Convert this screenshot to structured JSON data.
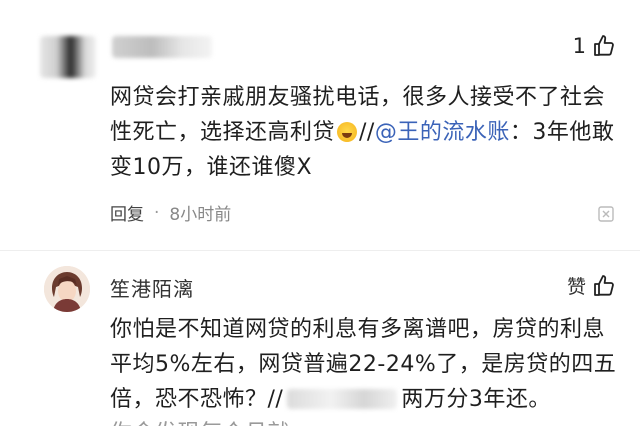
{
  "comment1": {
    "like_count": "1",
    "text_part1": "网贷会打亲戚朋友骚扰电话，很多人接受不了社会性死亡，选择还高利贷",
    "text_part2": "//",
    "mention": "@王的流水账",
    "text_part3": "：3年他敢变10万，谁还谁傻X",
    "reply_label": "回复",
    "dot": "·",
    "time": "8小时前"
  },
  "comment2": {
    "username": "笙港陌漓",
    "like_label": "赞",
    "text_part1": "你怕是不知道网贷的利息有多离谱吧，房贷的利息平均5%左右，网贷普遍22-24%了，是房贷的四五倍，恐不恐怖？//",
    "text_part2": "两万分3年还。",
    "cut_text": "你会发现每个月就"
  },
  "icons": {
    "like": "thumbs-up-icon",
    "more": "more-icon",
    "emoji": "laughing-crying-emoji-icon"
  },
  "colors": {
    "mention": "#3b63b8",
    "text": "#1f1f1f",
    "meta": "#888888"
  }
}
